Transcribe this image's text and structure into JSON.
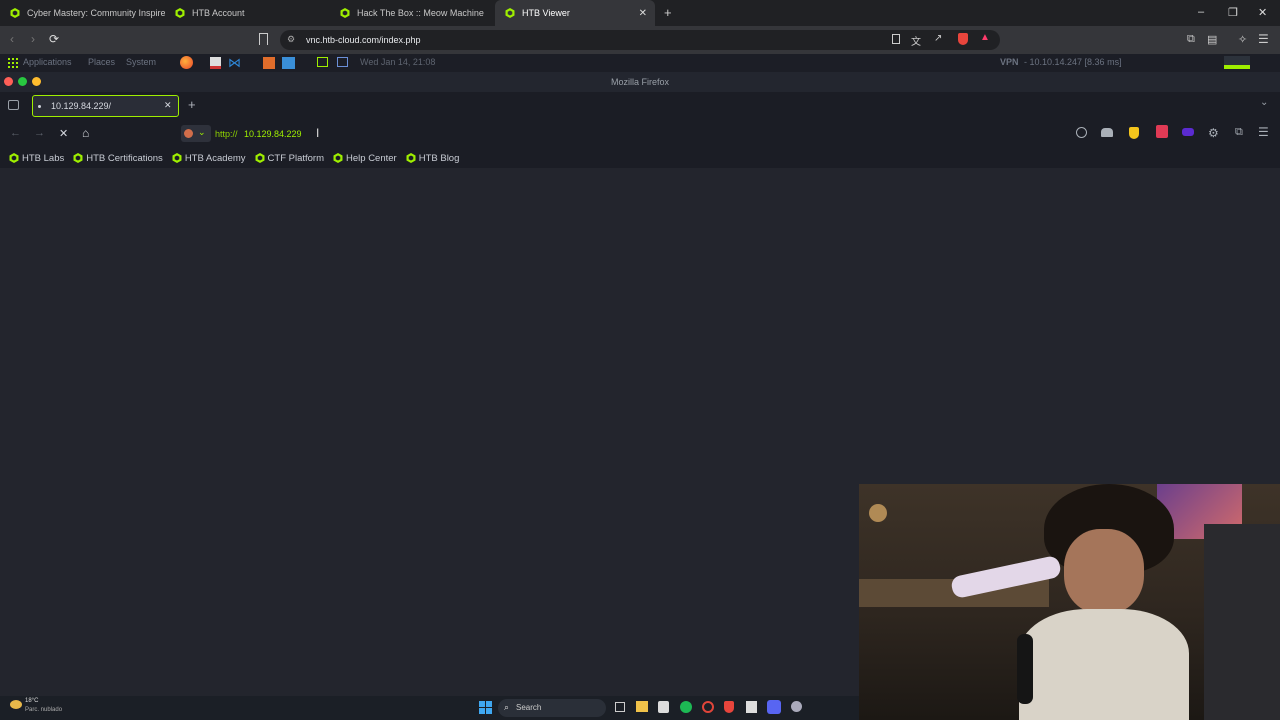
{
  "outer_browser": {
    "tabs": [
      {
        "title": "Cyber Mastery: Community Inspired",
        "active": false
      },
      {
        "title": "HTB Account",
        "active": false
      },
      {
        "title": "Hack The Box :: Meow Machine",
        "active": false
      },
      {
        "title": "HTB Viewer",
        "active": true
      }
    ],
    "url": "vnc.htb-cloud.com/index.php"
  },
  "desktop_panel": {
    "menus": [
      "Applications",
      "Places",
      "System"
    ],
    "datetime": "Wed Jan 14, 21:08",
    "vpn_label": "VPN",
    "vpn_value": "- 10.10.14.247 [8.36 ms]"
  },
  "firefox": {
    "window_title": "Mozilla Firefox",
    "tab_title": "10.129.84.229/",
    "url_scheme": "http://",
    "url_host": "10.129.84.229",
    "bookmarks": [
      "HTB Labs",
      "HTB Certifications",
      "HTB Academy",
      "CTF Platform",
      "Help Center",
      "HTB Blog"
    ]
  },
  "taskbar": {
    "weather_temp": "18°C",
    "weather_desc": "Parc. nublado",
    "search_label": "Search"
  },
  "colors": {
    "htb_green": "#9fef00",
    "bg": "#23252d"
  }
}
